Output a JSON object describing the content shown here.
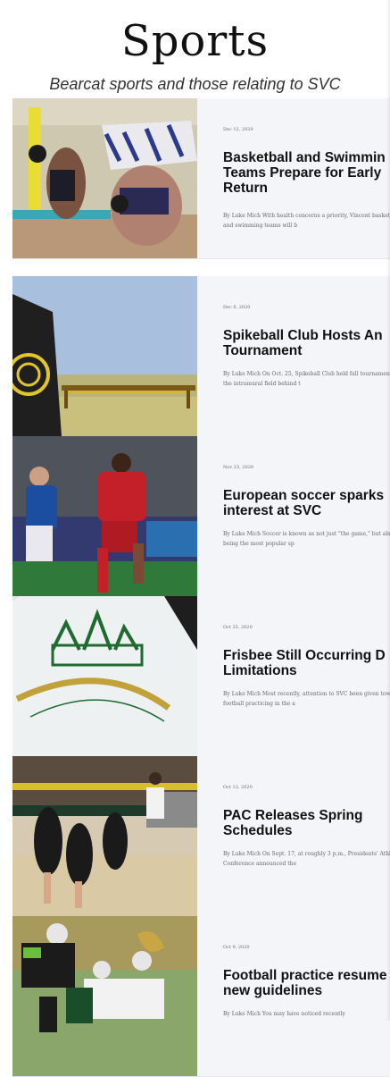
{
  "header": {
    "title": "Sports",
    "subtitle": "Bearcat sports and those relating to SVC"
  },
  "articles": [
    {
      "date": "Dec 12, 2020",
      "headline": "Basketball and Swimmin Teams Prepare for Early Return",
      "excerpt": "By Luke Mich With health concerns a priority, Vincent basketball and swimming teams will b",
      "image_icon": "swimmers-photo"
    },
    {
      "date": "Dec 8, 2020",
      "headline": "Spikeball Club Hosts An Tournament",
      "excerpt": "By Luke Mich On Oct. 25, Spikeball Club held fall tournament on the intramural field behind t",
      "image_icon": "spikeball-photo"
    },
    {
      "date": "Nov 23, 2020",
      "headline": "European soccer sparks interest at SVC",
      "excerpt": "By Luke Mich Soccer is known as not just \"the game,\" but also for being the most popular sp",
      "image_icon": "soccer-photo"
    },
    {
      "date": "Oct 25, 2020",
      "headline": "Frisbee Still Occurring D Limitations",
      "excerpt": "By Luke Mich Most recently, attention to SVC been given towards football practicing in the a",
      "image_icon": "frisbee-photo"
    },
    {
      "date": "Oct 13, 2020",
      "headline": "PAC Releases Spring Schedules",
      "excerpt": "By Luke Mich On Sept. 17, at roughly 3 p.m., Presidents' Athletic Conference announced the",
      "image_icon": "volleyball-photo"
    },
    {
      "date": "Oct 9, 2020",
      "headline": "Football practice resume new guidelines",
      "excerpt": "By Luke Mich You may have noticed recently",
      "image_icon": "football-photo"
    }
  ]
}
